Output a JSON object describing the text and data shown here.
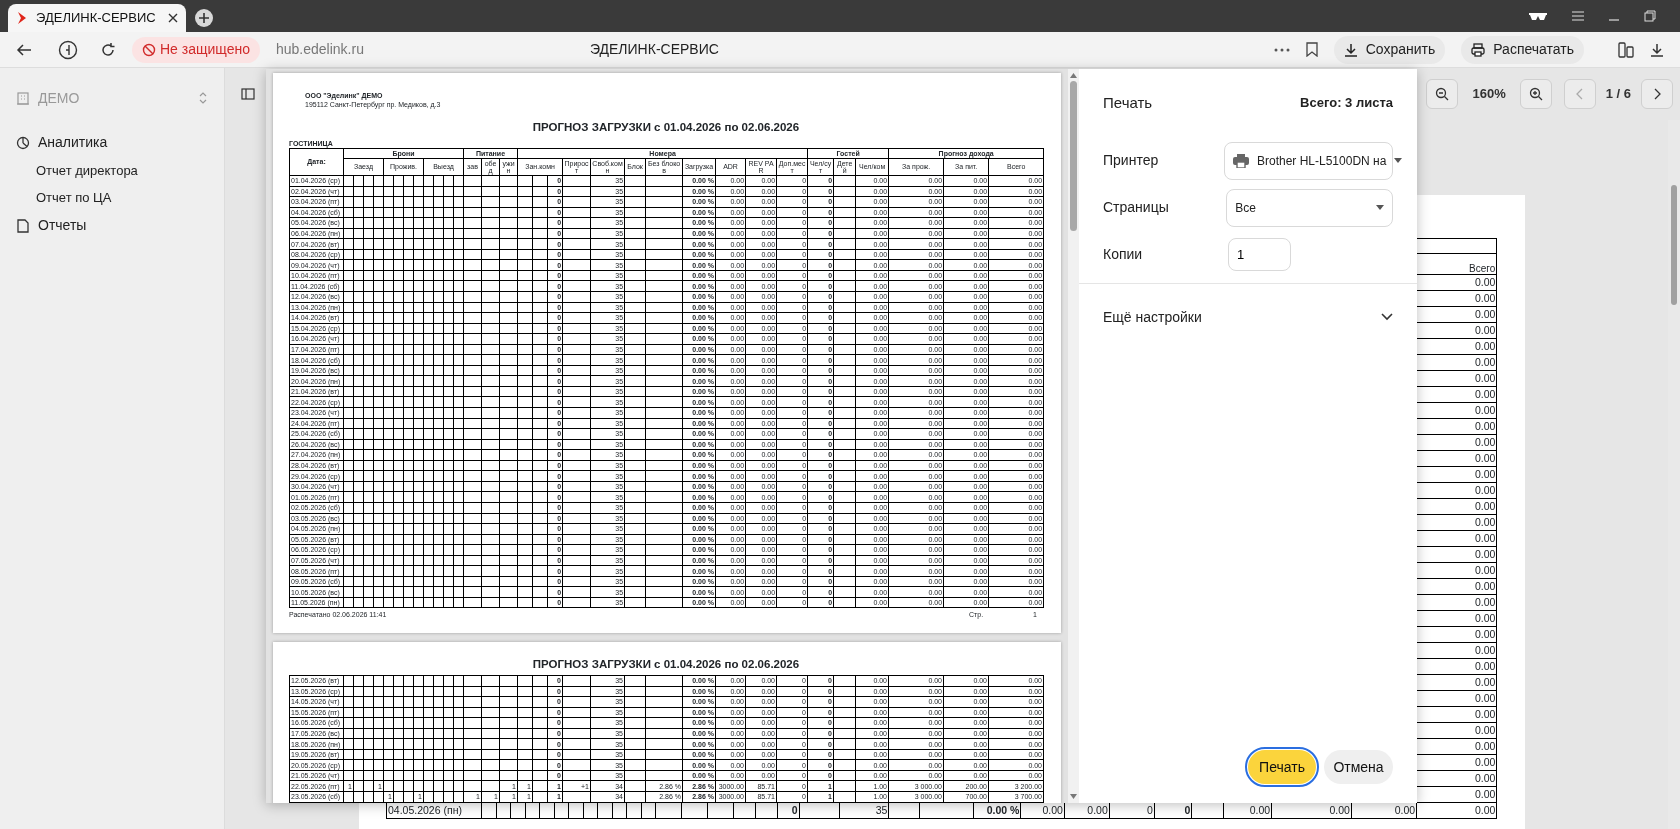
{
  "browser": {
    "tab": {
      "title": "ЭДЕЛИНК-СЕРВИС",
      "selected": true
    },
    "security": "Не защищено",
    "url": "hub.edelink.ru",
    "page_title": "ЭДЕЛИНК-СЕРВИС",
    "actions": [
      "Сохранить",
      "Распечатать"
    ]
  },
  "sidebar": {
    "org": "ДЕМО",
    "items": [
      {
        "label": "Аналитика",
        "children": [
          {
            "label": "Отчет директора"
          },
          {
            "label": "Отчет по ЦА"
          }
        ]
      },
      {
        "label": "Отчеты"
      }
    ]
  },
  "viewer": {
    "zoom": "160%",
    "page": "1 / 6"
  },
  "background_report": {
    "total_header": "Всего",
    "rows": [
      {
        "total": "0.00"
      },
      {
        "total": "0.00"
      },
      {
        "total": "0.00"
      },
      {
        "total": "0.00"
      },
      {
        "total": "0.00"
      },
      {
        "total": "0.00"
      },
      {
        "total": "0.00"
      },
      {
        "total": "0.00"
      },
      {
        "total": "0.00"
      },
      {
        "total": "0.00"
      },
      {
        "total": "0.00"
      },
      {
        "total": "0.00"
      },
      {
        "total": "0.00"
      },
      {
        "total": "0.00"
      },
      {
        "total": "0.00"
      },
      {
        "total": "0.00"
      },
      {
        "total": "0.00"
      },
      {
        "total": "0.00"
      },
      {
        "total": "0.00"
      },
      {
        "total": "0.00"
      },
      {
        "total": "0.00"
      },
      {
        "total": "0.00"
      },
      {
        "total": "0.00"
      },
      {
        "total": "0.00"
      },
      {
        "total": "0.00"
      },
      {
        "total": "0.00"
      },
      {
        "total": "0.00"
      },
      {
        "total": "0.00"
      },
      {
        "total": "0.00"
      },
      {
        "total": "0.00"
      },
      {
        "total": "0.00"
      },
      {
        "total": "0.00"
      },
      {
        "total": "0.00"
      },
      {
        "date": "04.05.2026 (пн)",
        "occupied": "0",
        "free": "35",
        "load": "0.00 %",
        "adr": "0.00",
        "revpar": "0.00",
        "extra": "0",
        "guests": "0",
        "per_room": "0.00",
        "stay": "0.00",
        "food": "0.00",
        "total": "0.00"
      }
    ]
  },
  "print_dialog": {
    "title": "Печать",
    "sheets": "Всего: 3 листа",
    "fields": [
      {
        "label": "Принтер",
        "kind": "printer",
        "value": "Brother HL-L5100DN на"
      },
      {
        "label": "Страницы",
        "kind": "select",
        "value": "Все"
      },
      {
        "label": "Копии",
        "kind": "input",
        "value": "1"
      }
    ],
    "more": {
      "label": "Ещё настройки",
      "expanded": false
    },
    "buttons": [
      {
        "label": "Печать",
        "kind": "primary"
      },
      {
        "label": "Отмена",
        "kind": "secondary"
      }
    ],
    "preview": {
      "pages": [
        {
          "company": "ООО \"Эделинк\" ДЕМО",
          "address": "195112 Санкт-Петербург пр. Медиков, д.3",
          "title": "ПРОГНОЗ ЗАГРУЗКИ с 01.04.2026 по 02.06.2026",
          "section": "ГОСТИНИЦА",
          "header": {
            "date": "Дата:",
            "bookings": "Брони",
            "booking_groups": [
              "Заезд",
              "Прожив.",
              "Выезд"
            ],
            "meals": "Питание",
            "meal_columns": [
              "зав",
              "обед",
              "ужин"
            ],
            "rooms": "Номера",
            "occupied": "Зан.комн",
            "room_columns": [
              "Прирост",
              "Своб.комн",
              "Блок",
              "Без блоков",
              "Загрузка",
              "ADR",
              "REV PAR",
              "Доп.мест"
            ],
            "guests": "Гостей",
            "guest_columns": [
              "Чел/сут",
              "Детей",
              "Чел/ком"
            ],
            "revenue": "Прогноз дохода",
            "revenue_columns": [
              "За прож.",
              "За пит.",
              "Всего"
            ]
          },
          "rows": [
            {
              "date": "01.04.2026 (ср)",
              "occupied": "0",
              "free": "35",
              "load": "0.00 %",
              "adr": "0.00",
              "revpar": "0.00",
              "extra": "0",
              "guests": "0",
              "per_room": "0.00",
              "stay": "0.00",
              "food": "0.00",
              "total": "0.00"
            },
            {
              "date": "02.04.2026 (чт)",
              "occupied": "0",
              "free": "35",
              "load": "0.00 %",
              "adr": "0.00",
              "revpar": "0.00",
              "extra": "0",
              "guests": "0",
              "per_room": "0.00",
              "stay": "0.00",
              "food": "0.00",
              "total": "0.00"
            },
            {
              "date": "03.04.2026 (пт)",
              "occupied": "0",
              "free": "35",
              "load": "0.00 %",
              "adr": "0.00",
              "revpar": "0.00",
              "extra": "0",
              "guests": "0",
              "per_room": "0.00",
              "stay": "0.00",
              "food": "0.00",
              "total": "0.00"
            },
            {
              "date": "04.04.2026 (сб)",
              "occupied": "0",
              "free": "35",
              "load": "0.00 %",
              "adr": "0.00",
              "revpar": "0.00",
              "extra": "0",
              "guests": "0",
              "per_room": "0.00",
              "stay": "0.00",
              "food": "0.00",
              "total": "0.00"
            },
            {
              "date": "05.04.2026 (вс)",
              "occupied": "0",
              "free": "35",
              "load": "0.00 %",
              "adr": "0.00",
              "revpar": "0.00",
              "extra": "0",
              "guests": "0",
              "per_room": "0.00",
              "stay": "0.00",
              "food": "0.00",
              "total": "0.00"
            },
            {
              "date": "06.04.2026 (пн)",
              "occupied": "0",
              "free": "35",
              "load": "0.00 %",
              "adr": "0.00",
              "revpar": "0.00",
              "extra": "0",
              "guests": "0",
              "per_room": "0.00",
              "stay": "0.00",
              "food": "0.00",
              "total": "0.00"
            },
            {
              "date": "07.04.2026 (вт)",
              "occupied": "0",
              "free": "35",
              "load": "0.00 %",
              "adr": "0.00",
              "revpar": "0.00",
              "extra": "0",
              "guests": "0",
              "per_room": "0.00",
              "stay": "0.00",
              "food": "0.00",
              "total": "0.00"
            },
            {
              "date": "08.04.2026 (ср)",
              "occupied": "0",
              "free": "35",
              "load": "0.00 %",
              "adr": "0.00",
              "revpar": "0.00",
              "extra": "0",
              "guests": "0",
              "per_room": "0.00",
              "stay": "0.00",
              "food": "0.00",
              "total": "0.00"
            },
            {
              "date": "09.04.2026 (чт)",
              "occupied": "0",
              "free": "35",
              "load": "0.00 %",
              "adr": "0.00",
              "revpar": "0.00",
              "extra": "0",
              "guests": "0",
              "per_room": "0.00",
              "stay": "0.00",
              "food": "0.00",
              "total": "0.00"
            },
            {
              "date": "10.04.2026 (пт)",
              "occupied": "0",
              "free": "35",
              "load": "0.00 %",
              "adr": "0.00",
              "revpar": "0.00",
              "extra": "0",
              "guests": "0",
              "per_room": "0.00",
              "stay": "0.00",
              "food": "0.00",
              "total": "0.00"
            },
            {
              "date": "11.04.2026 (сб)",
              "occupied": "0",
              "free": "35",
              "load": "0.00 %",
              "adr": "0.00",
              "revpar": "0.00",
              "extra": "0",
              "guests": "0",
              "per_room": "0.00",
              "stay": "0.00",
              "food": "0.00",
              "total": "0.00"
            },
            {
              "date": "12.04.2026 (вс)",
              "occupied": "0",
              "free": "35",
              "load": "0.00 %",
              "adr": "0.00",
              "revpar": "0.00",
              "extra": "0",
              "guests": "0",
              "per_room": "0.00",
              "stay": "0.00",
              "food": "0.00",
              "total": "0.00"
            },
            {
              "date": "13.04.2026 (пн)",
              "occupied": "0",
              "free": "35",
              "load": "0.00 %",
              "adr": "0.00",
              "revpar": "0.00",
              "extra": "0",
              "guests": "0",
              "per_room": "0.00",
              "stay": "0.00",
              "food": "0.00",
              "total": "0.00"
            },
            {
              "date": "14.04.2026 (вт)",
              "occupied": "0",
              "free": "35",
              "load": "0.00 %",
              "adr": "0.00",
              "revpar": "0.00",
              "extra": "0",
              "guests": "0",
              "per_room": "0.00",
              "stay": "0.00",
              "food": "0.00",
              "total": "0.00"
            },
            {
              "date": "15.04.2026 (ср)",
              "occupied": "0",
              "free": "35",
              "load": "0.00 %",
              "adr": "0.00",
              "revpar": "0.00",
              "extra": "0",
              "guests": "0",
              "per_room": "0.00",
              "stay": "0.00",
              "food": "0.00",
              "total": "0.00"
            },
            {
              "date": "16.04.2026 (чт)",
              "occupied": "0",
              "free": "35",
              "load": "0.00 %",
              "adr": "0.00",
              "revpar": "0.00",
              "extra": "0",
              "guests": "0",
              "per_room": "0.00",
              "stay": "0.00",
              "food": "0.00",
              "total": "0.00"
            },
            {
              "date": "17.04.2026 (пт)",
              "occupied": "0",
              "free": "35",
              "load": "0.00 %",
              "adr": "0.00",
              "revpar": "0.00",
              "extra": "0",
              "guests": "0",
              "per_room": "0.00",
              "stay": "0.00",
              "food": "0.00",
              "total": "0.00"
            },
            {
              "date": "18.04.2026 (сб)",
              "occupied": "0",
              "free": "35",
              "load": "0.00 %",
              "adr": "0.00",
              "revpar": "0.00",
              "extra": "0",
              "guests": "0",
              "per_room": "0.00",
              "stay": "0.00",
              "food": "0.00",
              "total": "0.00"
            },
            {
              "date": "19.04.2026 (вс)",
              "occupied": "0",
              "free": "35",
              "load": "0.00 %",
              "adr": "0.00",
              "revpar": "0.00",
              "extra": "0",
              "guests": "0",
              "per_room": "0.00",
              "stay": "0.00",
              "food": "0.00",
              "total": "0.00"
            },
            {
              "date": "20.04.2026 (пн)",
              "occupied": "0",
              "free": "35",
              "load": "0.00 %",
              "adr": "0.00",
              "revpar": "0.00",
              "extra": "0",
              "guests": "0",
              "per_room": "0.00",
              "stay": "0.00",
              "food": "0.00",
              "total": "0.00"
            },
            {
              "date": "21.04.2026 (вт)",
              "occupied": "0",
              "free": "35",
              "load": "0.00 %",
              "adr": "0.00",
              "revpar": "0.00",
              "extra": "0",
              "guests": "0",
              "per_room": "0.00",
              "stay": "0.00",
              "food": "0.00",
              "total": "0.00"
            },
            {
              "date": "22.04.2026 (ср)",
              "occupied": "0",
              "free": "35",
              "load": "0.00 %",
              "adr": "0.00",
              "revpar": "0.00",
              "extra": "0",
              "guests": "0",
              "per_room": "0.00",
              "stay": "0.00",
              "food": "0.00",
              "total": "0.00"
            },
            {
              "date": "23.04.2026 (чт)",
              "occupied": "0",
              "free": "35",
              "load": "0.00 %",
              "adr": "0.00",
              "revpar": "0.00",
              "extra": "0",
              "guests": "0",
              "per_room": "0.00",
              "stay": "0.00",
              "food": "0.00",
              "total": "0.00"
            },
            {
              "date": "24.04.2026 (пт)",
              "occupied": "0",
              "free": "35",
              "load": "0.00 %",
              "adr": "0.00",
              "revpar": "0.00",
              "extra": "0",
              "guests": "0",
              "per_room": "0.00",
              "stay": "0.00",
              "food": "0.00",
              "total": "0.00"
            },
            {
              "date": "25.04.2026 (сб)",
              "occupied": "0",
              "free": "35",
              "load": "0.00 %",
              "adr": "0.00",
              "revpar": "0.00",
              "extra": "0",
              "guests": "0",
              "per_room": "0.00",
              "stay": "0.00",
              "food": "0.00",
              "total": "0.00"
            },
            {
              "date": "26.04.2026 (вс)",
              "occupied": "0",
              "free": "35",
              "load": "0.00 %",
              "adr": "0.00",
              "revpar": "0.00",
              "extra": "0",
              "guests": "0",
              "per_room": "0.00",
              "stay": "0.00",
              "food": "0.00",
              "total": "0.00"
            },
            {
              "date": "27.04.2026 (пн)",
              "occupied": "0",
              "free": "35",
              "load": "0.00 %",
              "adr": "0.00",
              "revpar": "0.00",
              "extra": "0",
              "guests": "0",
              "per_room": "0.00",
              "stay": "0.00",
              "food": "0.00",
              "total": "0.00"
            },
            {
              "date": "28.04.2026 (вт)",
              "occupied": "0",
              "free": "35",
              "load": "0.00 %",
              "adr": "0.00",
              "revpar": "0.00",
              "extra": "0",
              "guests": "0",
              "per_room": "0.00",
              "stay": "0.00",
              "food": "0.00",
              "total": "0.00"
            },
            {
              "date": "29.04.2026 (ср)",
              "occupied": "0",
              "free": "35",
              "load": "0.00 %",
              "adr": "0.00",
              "revpar": "0.00",
              "extra": "0",
              "guests": "0",
              "per_room": "0.00",
              "stay": "0.00",
              "food": "0.00",
              "total": "0.00"
            },
            {
              "date": "30.04.2026 (чт)",
              "occupied": "0",
              "free": "35",
              "load": "0.00 %",
              "adr": "0.00",
              "revpar": "0.00",
              "extra": "0",
              "guests": "0",
              "per_room": "0.00",
              "stay": "0.00",
              "food": "0.00",
              "total": "0.00"
            },
            {
              "date": "01.05.2026 (пт)",
              "occupied": "0",
              "free": "35",
              "load": "0.00 %",
              "adr": "0.00",
              "revpar": "0.00",
              "extra": "0",
              "guests": "0",
              "per_room": "0.00",
              "stay": "0.00",
              "food": "0.00",
              "total": "0.00"
            },
            {
              "date": "02.05.2026 (сб)",
              "occupied": "0",
              "free": "35",
              "load": "0.00 %",
              "adr": "0.00",
              "revpar": "0.00",
              "extra": "0",
              "guests": "0",
              "per_room": "0.00",
              "stay": "0.00",
              "food": "0.00",
              "total": "0.00"
            },
            {
              "date": "03.05.2026 (вс)",
              "occupied": "0",
              "free": "35",
              "load": "0.00 %",
              "adr": "0.00",
              "revpar": "0.00",
              "extra": "0",
              "guests": "0",
              "per_room": "0.00",
              "stay": "0.00",
              "food": "0.00",
              "total": "0.00"
            },
            {
              "date": "04.05.2026 (пн)",
              "occupied": "0",
              "free": "35",
              "load": "0.00 %",
              "adr": "0.00",
              "revpar": "0.00",
              "extra": "0",
              "guests": "0",
              "per_room": "0.00",
              "stay": "0.00",
              "food": "0.00",
              "total": "0.00"
            },
            {
              "date": "05.05.2026 (вт)",
              "occupied": "0",
              "free": "35",
              "load": "0.00 %",
              "adr": "0.00",
              "revpar": "0.00",
              "extra": "0",
              "guests": "0",
              "per_room": "0.00",
              "stay": "0.00",
              "food": "0.00",
              "total": "0.00"
            },
            {
              "date": "06.05.2026 (ср)",
              "occupied": "0",
              "free": "35",
              "load": "0.00 %",
              "adr": "0.00",
              "revpar": "0.00",
              "extra": "0",
              "guests": "0",
              "per_room": "0.00",
              "stay": "0.00",
              "food": "0.00",
              "total": "0.00"
            },
            {
              "date": "07.05.2026 (чт)",
              "occupied": "0",
              "free": "35",
              "load": "0.00 %",
              "adr": "0.00",
              "revpar": "0.00",
              "extra": "0",
              "guests": "0",
              "per_room": "0.00",
              "stay": "0.00",
              "food": "0.00",
              "total": "0.00"
            },
            {
              "date": "08.05.2026 (пт)",
              "occupied": "0",
              "free": "35",
              "load": "0.00 %",
              "adr": "0.00",
              "revpar": "0.00",
              "extra": "0",
              "guests": "0",
              "per_room": "0.00",
              "stay": "0.00",
              "food": "0.00",
              "total": "0.00"
            },
            {
              "date": "09.05.2026 (сб)",
              "occupied": "0",
              "free": "35",
              "load": "0.00 %",
              "adr": "0.00",
              "revpar": "0.00",
              "extra": "0",
              "guests": "0",
              "per_room": "0.00",
              "stay": "0.00",
              "food": "0.00",
              "total": "0.00"
            },
            {
              "date": "10.05.2026 (вс)",
              "occupied": "0",
              "free": "35",
              "load": "0.00 %",
              "adr": "0.00",
              "revpar": "0.00",
              "extra": "0",
              "guests": "0",
              "per_room": "0.00",
              "stay": "0.00",
              "food": "0.00",
              "total": "0.00"
            },
            {
              "date": "11.05.2026 (пн)",
              "occupied": "0",
              "free": "35",
              "load": "0.00 %",
              "adr": "0.00",
              "revpar": "0.00",
              "extra": "0",
              "guests": "0",
              "per_room": "0.00",
              "stay": "0.00",
              "food": "0.00",
              "total": "0.00"
            }
          ],
          "printed": "Распечатано 02.06.2026 11:41",
          "page_label": "Стр.",
          "page_number": "1"
        },
        {
          "title": "ПРОГНОЗ ЗАГРУЗКИ с 01.04.2026 по 02.06.2026",
          "rows": [
            {
              "date": "12.05.2026 (вт)",
              "occupied": "0",
              "free": "35",
              "load": "0.00 %",
              "adr": "0.00",
              "revpar": "0.00",
              "extra": "0",
              "guests": "0",
              "per_room": "0.00",
              "stay": "0.00",
              "food": "0.00",
              "total": "0.00"
            },
            {
              "date": "13.05.2026 (ср)",
              "occupied": "0",
              "free": "35",
              "load": "0.00 %",
              "adr": "0.00",
              "revpar": "0.00",
              "extra": "0",
              "guests": "0",
              "per_room": "0.00",
              "stay": "0.00",
              "food": "0.00",
              "total": "0.00"
            },
            {
              "date": "14.05.2026 (чт)",
              "occupied": "0",
              "free": "35",
              "load": "0.00 %",
              "adr": "0.00",
              "revpar": "0.00",
              "extra": "0",
              "guests": "0",
              "per_room": "0.00",
              "stay": "0.00",
              "food": "0.00",
              "total": "0.00"
            },
            {
              "date": "15.05.2026 (пт)",
              "occupied": "0",
              "free": "35",
              "load": "0.00 %",
              "adr": "0.00",
              "revpar": "0.00",
              "extra": "0",
              "guests": "0",
              "per_room": "0.00",
              "stay": "0.00",
              "food": "0.00",
              "total": "0.00"
            },
            {
              "date": "16.05.2026 (сб)",
              "occupied": "0",
              "free": "35",
              "load": "0.00 %",
              "adr": "0.00",
              "revpar": "0.00",
              "extra": "0",
              "guests": "0",
              "per_room": "0.00",
              "stay": "0.00",
              "food": "0.00",
              "total": "0.00"
            },
            {
              "date": "17.05.2026 (вс)",
              "occupied": "0",
              "free": "35",
              "load": "0.00 %",
              "adr": "0.00",
              "revpar": "0.00",
              "extra": "0",
              "guests": "0",
              "per_room": "0.00",
              "stay": "0.00",
              "food": "0.00",
              "total": "0.00"
            },
            {
              "date": "18.05.2026 (пн)",
              "occupied": "0",
              "free": "35",
              "load": "0.00 %",
              "adr": "0.00",
              "revpar": "0.00",
              "extra": "0",
              "guests": "0",
              "per_room": "0.00",
              "stay": "0.00",
              "food": "0.00",
              "total": "0.00"
            },
            {
              "date": "19.05.2026 (вт)",
              "occupied": "0",
              "free": "35",
              "load": "0.00 %",
              "adr": "0.00",
              "revpar": "0.00",
              "extra": "0",
              "guests": "0",
              "per_room": "0.00",
              "stay": "0.00",
              "food": "0.00",
              "total": "0.00"
            },
            {
              "date": "20.05.2026 (ср)",
              "occupied": "0",
              "free": "35",
              "load": "0.00 %",
              "adr": "0.00",
              "revpar": "0.00",
              "extra": "0",
              "guests": "0",
              "per_room": "0.00",
              "stay": "0.00",
              "food": "0.00",
              "total": "0.00"
            },
            {
              "date": "21.05.2026 (чт)",
              "occupied": "0",
              "free": "35",
              "load": "0.00 %",
              "adr": "0.00",
              "revpar": "0.00",
              "extra": "0",
              "guests": "0",
              "per_room": "0.00",
              "stay": "0.00",
              "food": "0.00",
              "total": "0.00"
            },
            {
              "date": "22.05.2026 (пт)",
              "b1": "1",
              "b4": "1",
              "f3": "1",
              "r1": "1",
              "occupied": "1",
              "growth": "+1",
              "free": "34",
              "noblock": "2.86 %",
              "load": "2.86 %",
              "adr": "3000.00",
              "revpar": "85.71",
              "extra": "0",
              "guests": "1",
              "per_room": "1.00",
              "stay": "3 000.00",
              "food": "200.00",
              "total": "3 200.00"
            },
            {
              "date": "23.05.2026 (сб)",
              "b5": "1",
              "b8": "1",
              "f1": "1",
              "f2": "1",
              "f3": "1",
              "r1": "1",
              "occupied": "1",
              "free": "34",
              "noblock": "2.86 %",
              "load": "2.86 %",
              "adr": "3000.00",
              "revpar": "85.71",
              "extra": "0",
              "guests": "1",
              "per_room": "1.00",
              "stay": "3 000.00",
              "food": "700.00",
              "total": "3 700.00"
            }
          ]
        }
      ]
    }
  }
}
